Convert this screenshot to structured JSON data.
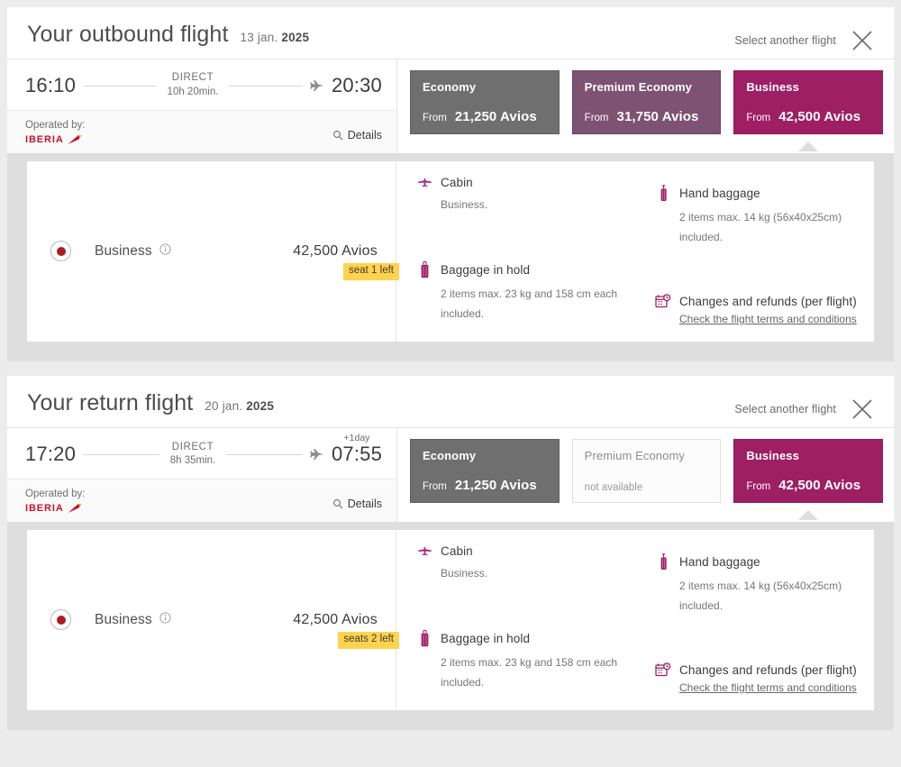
{
  "page": {
    "background": "#ececec"
  },
  "colors": {
    "economy": "#6f6f6f",
    "premium": "#7d5272",
    "business": "#9e1f63",
    "badge": "#ffd34d",
    "iberia_red": "#c8102e",
    "radio_dot": "#b01c1c"
  },
  "flights": [
    {
      "id": "outbound",
      "title": "Your outbound flight",
      "date_day": "13 jan. ",
      "date_year": "2025",
      "select_another_label": "Select another flight",
      "close_icon": "close-icon",
      "leg": {
        "depart_time": "16:10",
        "arrive_time": "20:30",
        "arrive_plus_day": "",
        "stop_type": "DIRECT",
        "duration": "10h 20min.",
        "operated_by_label": "Operated by:",
        "airline": "IBERIA",
        "details_label": "Details",
        "details_icon": "magnifier-icon",
        "plane_icon": "airplane-icon"
      },
      "tabs": [
        {
          "name": "Economy",
          "from_label": "From",
          "price": "21,250 Avios",
          "state": "economy",
          "selected": false
        },
        {
          "name": "Premium Economy",
          "from_label": "From",
          "price": "31,750 Avios",
          "state": "premium",
          "selected": false
        },
        {
          "name": "Business",
          "from_label": "From",
          "price": "42,500 Avios",
          "state": "business",
          "selected": true
        }
      ],
      "fare": {
        "name": "Business",
        "info_icon": "info-icon",
        "price": "42,500 Avios",
        "seat_badge": "seat 1 left",
        "radio_selected": true,
        "amenities": [
          {
            "icon": "airplane-front-icon",
            "title": "Cabin",
            "sub": "Business.",
            "link": ""
          },
          {
            "icon": "suitcase-icon",
            "title": "Baggage in hold",
            "sub": "2 items max. 23 kg and 158 cm each\nincluded.",
            "link": ""
          },
          {
            "icon": "carry-on-bag-icon",
            "title": "Hand baggage",
            "sub": "2 items max. 14 kg (56x40x25cm)\nincluded.",
            "link": ""
          },
          {
            "icon": "calendar-clock-icon",
            "title": "Changes and refunds (per flight)",
            "sub": "",
            "link": "Check the flight terms and conditions"
          }
        ]
      }
    },
    {
      "id": "return",
      "title": "Your return flight",
      "date_day": "20 jan. ",
      "date_year": "2025",
      "select_another_label": "Select another flight",
      "close_icon": "close-icon",
      "leg": {
        "depart_time": "17:20",
        "arrive_time": "07:55",
        "arrive_plus_day": "+1day",
        "stop_type": "DIRECT",
        "duration": "8h 35min.",
        "operated_by_label": "Operated by:",
        "airline": "IBERIA",
        "details_label": "Details",
        "details_icon": "magnifier-icon",
        "plane_icon": "airplane-icon"
      },
      "tabs": [
        {
          "name": "Economy",
          "from_label": "From",
          "price": "21,250 Avios",
          "state": "economy",
          "selected": false
        },
        {
          "name": "Premium Economy",
          "from_label": "",
          "price": "",
          "na_label": "not available",
          "state": "unavailable",
          "selected": false
        },
        {
          "name": "Business",
          "from_label": "From",
          "price": "42,500 Avios",
          "state": "business",
          "selected": true
        }
      ],
      "fare": {
        "name": "Business",
        "info_icon": "info-icon",
        "price": "42,500 Avios",
        "seat_badge": "seats 2 left",
        "radio_selected": true,
        "amenities": [
          {
            "icon": "airplane-front-icon",
            "title": "Cabin",
            "sub": "Business.",
            "link": ""
          },
          {
            "icon": "suitcase-icon",
            "title": "Baggage in hold",
            "sub": "2 items max. 23 kg and 158 cm each\nincluded.",
            "link": ""
          },
          {
            "icon": "carry-on-bag-icon",
            "title": "Hand baggage",
            "sub": "2 items max. 14 kg (56x40x25cm)\nincluded.",
            "link": ""
          },
          {
            "icon": "calendar-clock-icon",
            "title": "Changes and refunds (per flight)",
            "sub": "",
            "link": "Check the flight terms and conditions"
          }
        ]
      }
    }
  ]
}
